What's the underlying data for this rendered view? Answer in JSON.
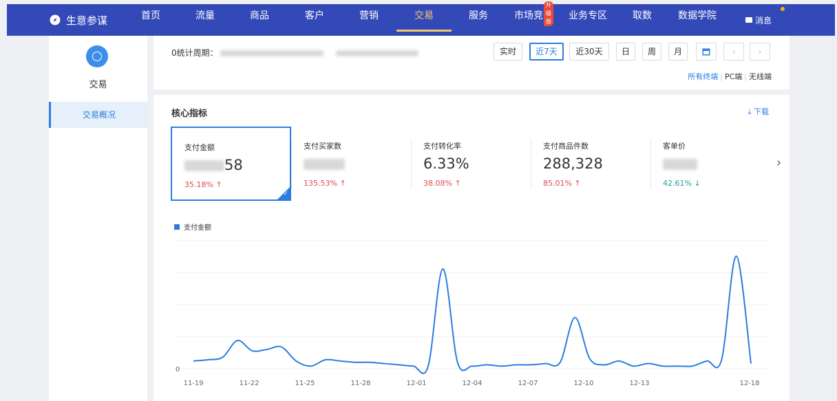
{
  "nav": {
    "brand": "生意参谋",
    "items": [
      "首页",
      "流量",
      "商品",
      "客户",
      "营销",
      "交易",
      "服务",
      "市场竞争",
      "业务专区",
      "取数",
      "数据学院"
    ],
    "active": "交易",
    "badge": "升级版",
    "message": "消息"
  },
  "sidebar": {
    "title": "交易",
    "item": "交易概况"
  },
  "period": {
    "label": "0统计周期：",
    "buttons": [
      "实时",
      "近7天",
      "近30天",
      "日",
      "周",
      "月"
    ],
    "selected": "近7天",
    "terminals": [
      "所有终端",
      "PC端",
      "无线端"
    ]
  },
  "core": {
    "title": "核心指标",
    "download": "下载",
    "metrics": [
      {
        "name": "支付金额",
        "value": "",
        "value_tail": "58",
        "change": "35.18%",
        "dir": "up"
      },
      {
        "name": "支付买家数",
        "value": "",
        "value_tail": "",
        "change": "135.53%",
        "dir": "up"
      },
      {
        "name": "支付转化率",
        "value": "6.33%",
        "value_tail": "",
        "change": "38.08%",
        "dir": "up"
      },
      {
        "name": "支付商品件数",
        "value": "288,328",
        "value_tail": "",
        "change": "85.01%",
        "dir": "up"
      },
      {
        "name": "客单价",
        "value": "",
        "value_tail": "",
        "change": "42.61%",
        "dir": "down"
      }
    ],
    "legend": "支付金额"
  },
  "colors": {
    "nav_bg": "#3449b8",
    "accent": "#2b7de0",
    "up": "#e04b4b",
    "down": "#1aa39a",
    "active_nav": "#f5c76b"
  },
  "chart_data": {
    "type": "line",
    "series": [
      {
        "name": "支付金额",
        "values": [
          6,
          7,
          9,
          22,
          14,
          15,
          17,
          6,
          2,
          7,
          6,
          5,
          5,
          4,
          3,
          2,
          2,
          78,
          5,
          2,
          3,
          2,
          3,
          3,
          4,
          5,
          40,
          8,
          3,
          6,
          2,
          4,
          2,
          2,
          2,
          6,
          7,
          88,
          4
        ]
      },
      {
        "name": "",
        "values": []
      }
    ],
    "x_tick_labels": [
      "11-19",
      "11-22",
      "11-25",
      "11-28",
      "12-01",
      "12-04",
      "12-07",
      "12-10",
      "12-13",
      "12-18"
    ],
    "y_tick_labels": [
      "0"
    ],
    "ylim": [
      0,
      100
    ],
    "grid": true
  }
}
